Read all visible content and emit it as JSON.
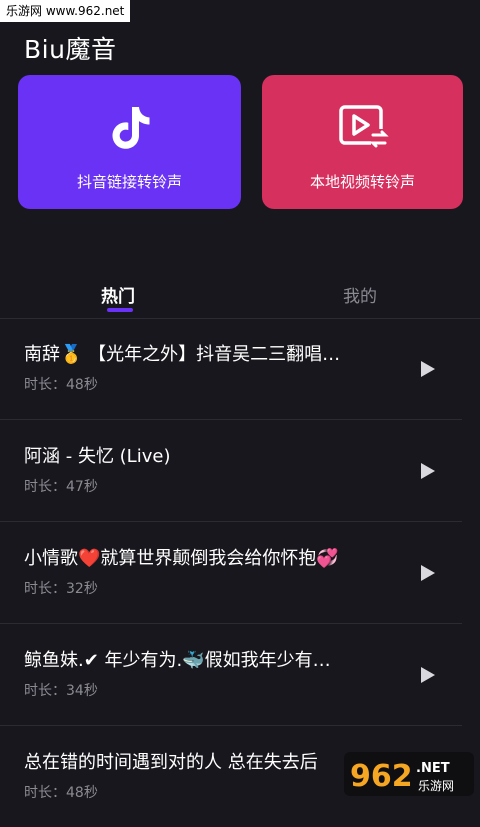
{
  "watermark_top": "乐游网 www.962.net",
  "app": {
    "title": "Biu魔音"
  },
  "cards": {
    "douyin": {
      "label": "抖音链接转铃声",
      "color": "#6a32f5",
      "icon": "tiktok-icon"
    },
    "local": {
      "label": "本地视频转铃声",
      "color": "#d6305e",
      "icon": "video-convert-icon"
    }
  },
  "tabs": {
    "hot": "热门",
    "mine": "我的",
    "active": "hot",
    "accent": "#6a32f5"
  },
  "songs": [
    {
      "title": "南辞🥇 【光年之外】抖音吴二三翻唱…",
      "duration": "时长：48秒"
    },
    {
      "title": "阿涵 - 失忆 (Live)",
      "duration": "时长：47秒"
    },
    {
      "title": "小情歌❤️就算世界颠倒我会给你怀抱💞",
      "duration": "时长：32秒"
    },
    {
      "title": "鲸鱼妹.✔ 年少有为.🐳假如我年少有…",
      "duration": "时长：34秒"
    },
    {
      "title": "总在错的时间遇到对的人 总在失去后",
      "duration": "时长：48秒"
    }
  ],
  "watermark_bottom": {
    "brand": "962",
    "suffix": ".NET",
    "name": "乐游网"
  }
}
